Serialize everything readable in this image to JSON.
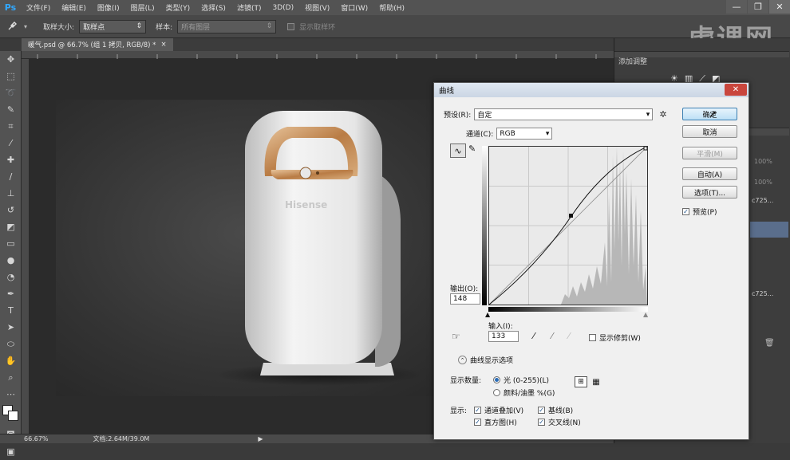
{
  "app": {
    "logo": "Ps",
    "menu": [
      "文件(F)",
      "编辑(E)",
      "图像(I)",
      "图层(L)",
      "类型(Y)",
      "选择(S)",
      "滤镜(T)",
      "3D(D)",
      "视图(V)",
      "窗口(W)",
      "帮助(H)"
    ],
    "window_controls": {
      "minimize": "—",
      "restore": "❐",
      "close": "✕"
    }
  },
  "options_bar": {
    "sample_size_label": "取样大小:",
    "sample_size_value": "取样点",
    "sample_label": "样本:",
    "sample_value": "所有图层",
    "show_ring_label": "显示取样环"
  },
  "watermark": "虎课网",
  "document_tab": {
    "title": "暖气.psd @ 66.7% (组 1 拷贝, RGB/8) *",
    "close": "×"
  },
  "status_bar": {
    "zoom": "66.67%",
    "doc_size": "文档:2.64M/39.0M"
  },
  "right_panel": {
    "adjustments_title": "添加调整",
    "opacity_1": "100%",
    "opacity_2": "100%",
    "layer_text_1": "c725...",
    "layer_text_2": "c725..."
  },
  "product": {
    "brand": "Hisense"
  },
  "curves_dialog": {
    "title": "曲线",
    "close": "✕",
    "preset_label": "预设(R):",
    "preset_value": "自定",
    "channel_label": "通道(C):",
    "channel_value": "RGB",
    "output_label": "输出(O):",
    "output_value": "148",
    "input_label": "输入(I):",
    "input_value": "133",
    "show_clipping_label": "显示修剪(W)",
    "show_clipping_checked": false,
    "display_options_label": "曲线显示选项",
    "show_amount_label": "显示数量:",
    "light_label": "光 (0-255)(L)",
    "pigment_label": "颜料/油墨 %(G)",
    "show_label": "显示:",
    "channel_overlay_label": "通道叠加(V)",
    "baseline_label": "基线(B)",
    "histogram_label": "直方图(H)",
    "intersection_label": "交叉线(N)",
    "buttons": {
      "ok": "确定",
      "cancel": "取消",
      "smooth": "平滑(M)",
      "auto": "自动(A)",
      "options": "选项(T)..."
    },
    "preview_label": "预览(P)",
    "preview_checked": true
  }
}
